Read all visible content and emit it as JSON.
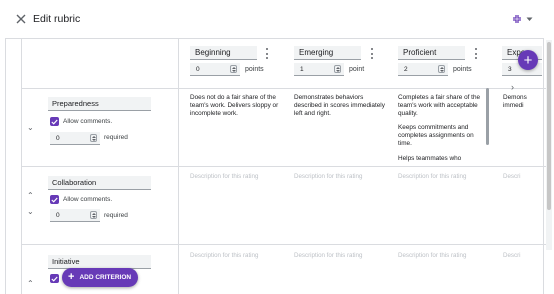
{
  "header": {
    "title": "Edit rubric"
  },
  "levels": [
    {
      "name": "Beginning",
      "points": "0",
      "unit": "points"
    },
    {
      "name": "Emerging",
      "points": "1",
      "unit": "point"
    },
    {
      "name": "Proficient",
      "points": "2",
      "unit": "points"
    },
    {
      "name": "Expe",
      "points": "3",
      "unit": ""
    }
  ],
  "criteria": [
    {
      "name": "Preparedness",
      "allow_comments": "Allow comments.",
      "points": "0",
      "required": "required",
      "descriptions": [
        "Does not do a fair share of the team's work. Delivers sloppy or incomplete work.",
        "Demonstrates behaviors described in scores immediately left and right.",
        "Completes a fair share of the team's work with acceptable quality.",
        "Demons immedi"
      ],
      "extra_description": [
        "Keeps commitments and completes assignments on time.",
        "Helps teammates who"
      ]
    },
    {
      "name": "Collaboration",
      "allow_comments": "Allow comments.",
      "points": "0",
      "required": "required"
    },
    {
      "name": "Initiative"
    }
  ],
  "placeholder": "Description for this rating",
  "placeholder_short": "Descri",
  "add_criterion": "ADD CRITERION",
  "colors": {
    "accent": "#673ab7",
    "divider": "#dadce0",
    "field_bg": "#f1f3f4"
  },
  "icons": [
    "close-icon",
    "collapse-icon",
    "kebab-icon",
    "chevron-right-icon",
    "chevron-down-icon",
    "chevron-up-icon",
    "add-icon",
    "check-icon"
  ]
}
